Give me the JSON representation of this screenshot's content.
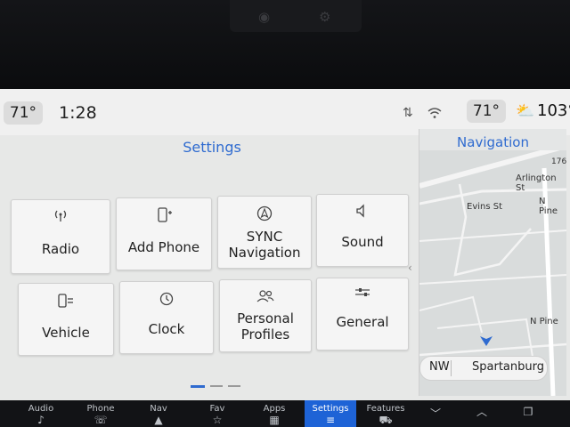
{
  "status": {
    "cabin_temp_left": "71°",
    "time": "1:28",
    "cabin_temp_right": "71°",
    "outside_temp": "103°"
  },
  "settings": {
    "title": "Settings",
    "tiles": [
      {
        "label_1": "Radio",
        "label_2": "",
        "icon": "radio-antenna-icon"
      },
      {
        "label_1": "Add Phone",
        "label_2": "",
        "icon": "add-phone-icon"
      },
      {
        "label_1": "SYNC",
        "label_2": "Navigation",
        "icon": "navigation-icon"
      },
      {
        "label_1": "Sound",
        "label_2": "",
        "icon": "speaker-icon"
      },
      {
        "label_1": "Vehicle",
        "label_2": "",
        "icon": "vehicle-icon"
      },
      {
        "label_1": "Clock",
        "label_2": "",
        "icon": "clock-icon"
      },
      {
        "label_1": "Personal",
        "label_2": "Profiles",
        "icon": "profiles-icon"
      },
      {
        "label_1": "General",
        "label_2": "",
        "icon": "sliders-icon"
      }
    ]
  },
  "navigation": {
    "title": "Navigation",
    "streets": [
      "Evins St",
      "Arlington St",
      "N Pine",
      "N Pine",
      "176"
    ],
    "heading": "NW",
    "city": "Spartanburg"
  },
  "bottom_nav": [
    {
      "label": "Audio"
    },
    {
      "label": "Phone"
    },
    {
      "label": "Nav"
    },
    {
      "label": "Fav"
    },
    {
      "label": "Apps"
    },
    {
      "label": "Settings"
    },
    {
      "label": "Features"
    }
  ],
  "colors": {
    "accent": "#2f6bd0",
    "active_tab": "#1e63d6"
  }
}
